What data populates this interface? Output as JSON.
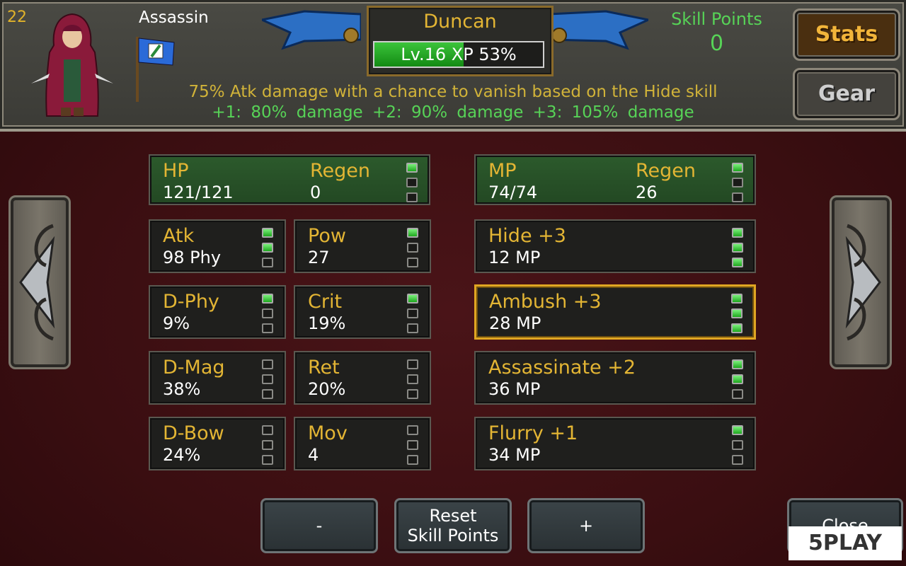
{
  "header": {
    "level_number": "22",
    "class_name": "Assassin",
    "character_name": "Duncan",
    "xp_text": "Lv.16  XP 53%",
    "xp_percent": 53,
    "description": "75% Atk damage with a chance to vanish based on the Hide skill",
    "description_tiers": "+1: 80% damage    +2: 90% damage    +3: 105% damage",
    "skill_points_label": "Skill Points",
    "skill_points_value": "0"
  },
  "tabs": {
    "stats_label": "Stats",
    "gear_label": "Gear"
  },
  "hp": {
    "label": "HP",
    "value": "121/121",
    "regen_label": "Regen",
    "regen_value": "0",
    "dots": [
      1,
      0,
      0
    ]
  },
  "mp": {
    "label": "MP",
    "value": "74/74",
    "regen_label": "Regen",
    "regen_value": "26",
    "dots": [
      1,
      0,
      0
    ]
  },
  "stats": [
    {
      "label": "Atk",
      "value": "98 Phy",
      "dots": [
        1,
        1,
        0
      ]
    },
    {
      "label": "Pow",
      "value": "27",
      "dots": [
        1,
        0,
        0
      ]
    },
    {
      "label": "D-Phy",
      "value": "9%",
      "dots": [
        1,
        0,
        0
      ]
    },
    {
      "label": "Crit",
      "value": "19%",
      "dots": [
        1,
        0,
        0
      ]
    },
    {
      "label": "D-Mag",
      "value": "38%",
      "dots": [
        0,
        0,
        0
      ]
    },
    {
      "label": "Ret",
      "value": "20%",
      "dots": [
        0,
        0,
        0
      ]
    },
    {
      "label": "D-Bow",
      "value": "24%",
      "dots": [
        0,
        0,
        0
      ]
    },
    {
      "label": "Mov",
      "value": "4",
      "dots": [
        0,
        0,
        0
      ]
    }
  ],
  "skills": [
    {
      "label": "Hide +3",
      "value": "12 MP",
      "dots": [
        1,
        1,
        1
      ],
      "selected": false
    },
    {
      "label": "Ambush +3",
      "value": "28 MP",
      "dots": [
        1,
        1,
        1
      ],
      "selected": true
    },
    {
      "label": "Assassinate +2",
      "value": "36 MP",
      "dots": [
        1,
        1,
        0
      ],
      "selected": false
    },
    {
      "label": "Flurry +1",
      "value": "34 MP",
      "dots": [
        1,
        0,
        0
      ],
      "selected": false
    }
  ],
  "bottom": {
    "minus_label": "-",
    "reset_line1": "Reset",
    "reset_line2": "Skill Points",
    "plus_label": "+",
    "close_label": "Close"
  },
  "watermark": "5PLAY",
  "colors": {
    "gold": "#e3b534",
    "green": "#57d357",
    "selected_border": "#e0a622"
  }
}
